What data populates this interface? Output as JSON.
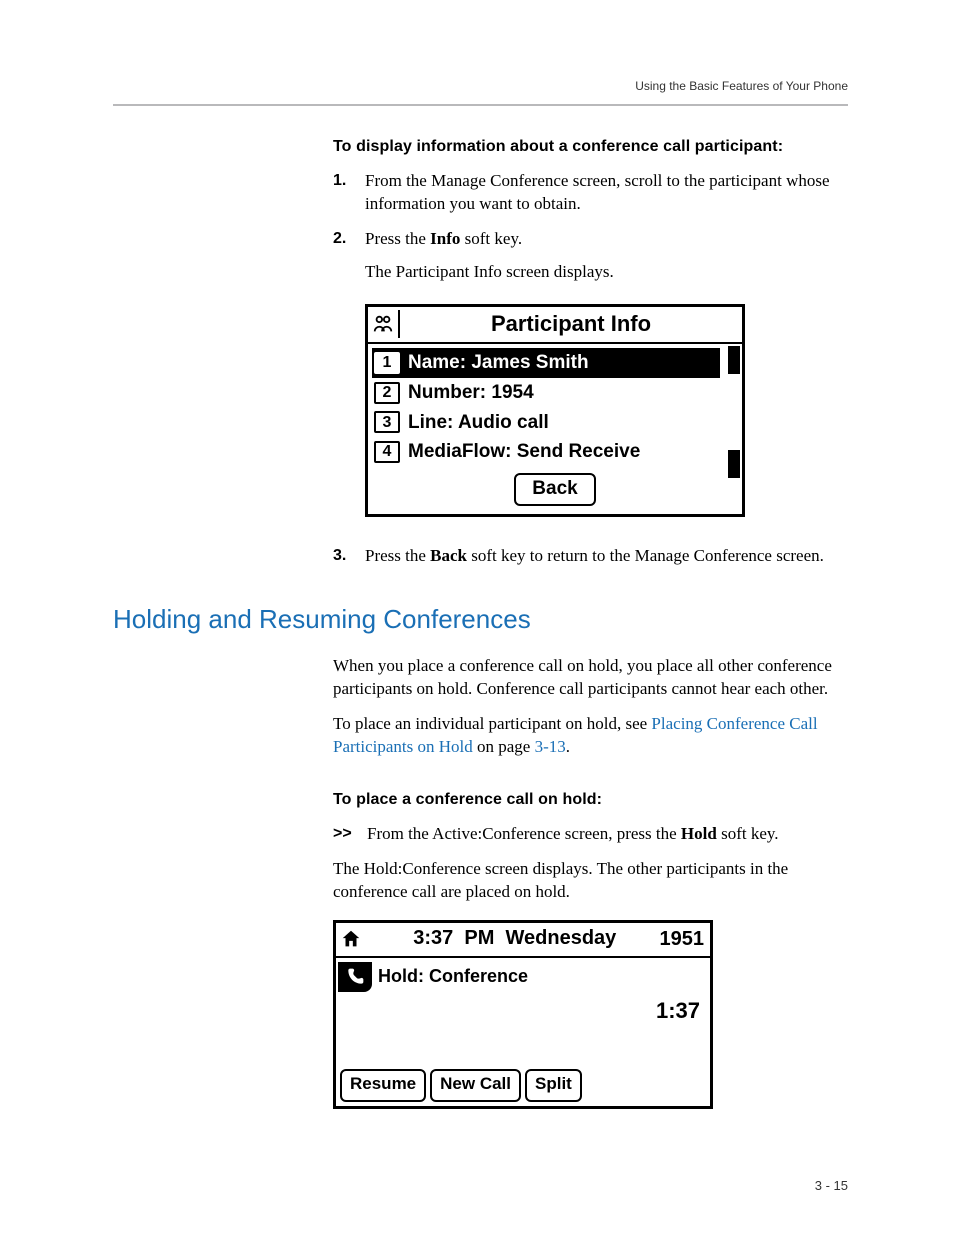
{
  "header": {
    "running_head": "Using the Basic Features of Your Phone"
  },
  "section1": {
    "subhead": "To display information about a conference call participant:",
    "steps": [
      {
        "num": "1.",
        "text": "From the Manage Conference screen, scroll to the participant whose information you want to obtain."
      },
      {
        "num": "2.",
        "text_before": "Press the ",
        "bold": "Info",
        "text_after": " soft key.",
        "follow": "The Participant Info screen displays."
      }
    ]
  },
  "participant_info_screen": {
    "title": "Participant Info",
    "rows": [
      {
        "n": "1",
        "label": "Name: James Smith",
        "selected": true
      },
      {
        "n": "2",
        "label": "Number: 1954",
        "selected": false
      },
      {
        "n": "3",
        "label": "Line: Audio call",
        "selected": false
      },
      {
        "n": "4",
        "label": "MediaFlow: Send Receive",
        "selected": false
      }
    ],
    "softkey": "Back"
  },
  "step3": {
    "num": "3.",
    "text_before": "Press the ",
    "bold": "Back",
    "text_after": " soft key to return to the Manage Conference screen."
  },
  "section2": {
    "heading": "Holding and Resuming Conferences",
    "para1": "When you place a conference call on hold, you place all other conference participants on hold. Conference call participants cannot hear each other.",
    "para2_a": "To place an individual participant on hold, see ",
    "para2_link": "Placing Conference Call Participants on Hold",
    "para2_b": " on page ",
    "para2_pageref": "3-13",
    "para2_c": ".",
    "subhead": "To place a conference call on hold:",
    "proc_arrow": ">>",
    "proc_text_a": "From the Active:Conference screen, press the ",
    "proc_bold": "Hold",
    "proc_text_b": " soft key.",
    "para3": "The Hold:Conference screen displays. The other participants in the conference call are placed on hold."
  },
  "hold_screen": {
    "time": "3:37",
    "ampm": "PM",
    "day": "Wednesday",
    "ext": "1951",
    "call_label": "Hold: Conference",
    "duration": "1:37",
    "softkeys": [
      "Resume",
      "New Call",
      "Split"
    ]
  },
  "page_number": "3 - 15"
}
